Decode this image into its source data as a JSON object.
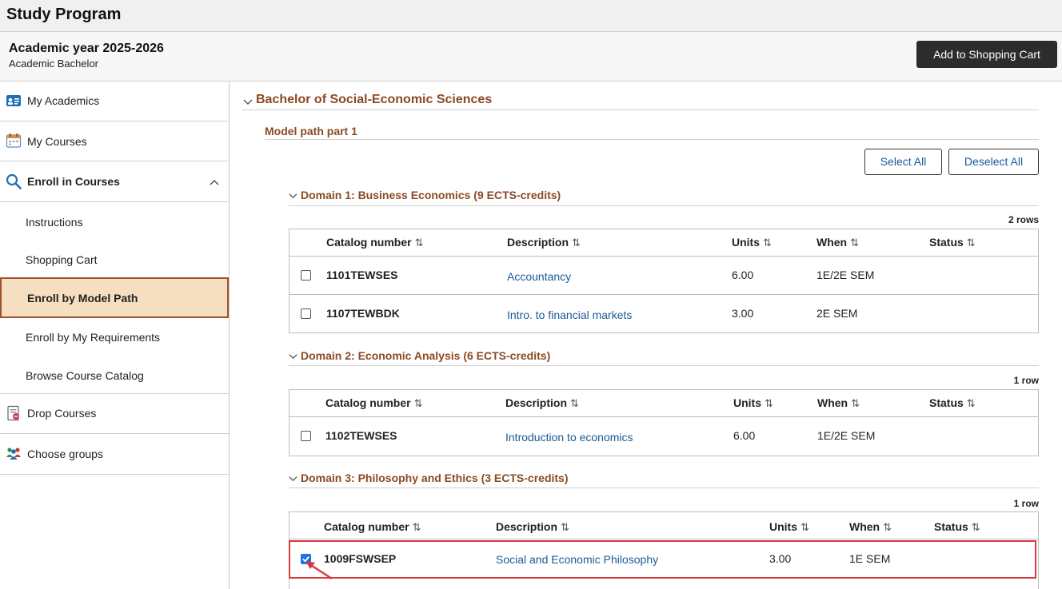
{
  "app": {
    "title": "Study Program"
  },
  "header": {
    "academic_year": "Academic year 2025-2026",
    "career": "Academic Bachelor",
    "add_to_cart_label": "Add to Shopping Cart"
  },
  "sidebar": {
    "items": [
      {
        "label": "My Academics",
        "icon": "id-card-icon"
      },
      {
        "label": "My Courses",
        "icon": "calendar-icon"
      },
      {
        "label": "Enroll in Courses",
        "icon": "search-icon"
      },
      {
        "label": "Instructions"
      },
      {
        "label": "Shopping Cart"
      },
      {
        "label": "Enroll by Model Path"
      },
      {
        "label": "Enroll by My Requirements"
      },
      {
        "label": "Browse Course Catalog"
      },
      {
        "label": "Drop Courses",
        "icon": "drop-doc-icon"
      },
      {
        "label": "Choose groups",
        "icon": "people-icon"
      }
    ],
    "active": "Enroll by Model Path"
  },
  "main": {
    "program_title": "Bachelor of Social-Economic Sciences",
    "model_path_title": "Model path part 1",
    "select_all_label": "Select All",
    "deselect_all_label": "Deselect All",
    "columns": [
      "Catalog number",
      "Description",
      "Units",
      "When",
      "Status"
    ],
    "sort_glyph": "⇅",
    "domains": [
      {
        "title": "Domain 1: Business Economics (9 ECTS-credits)",
        "rowcount": "2 rows",
        "rows": [
          {
            "catalog": "1101TEWSES",
            "description": "Accountancy",
            "units": "6.00",
            "when": "1E/2E SEM",
            "status": "",
            "checked": false
          },
          {
            "catalog": "1107TEWBDK",
            "description": "Intro. to financial markets",
            "units": "3.00",
            "when": "2E SEM",
            "status": "",
            "checked": false
          }
        ]
      },
      {
        "title": "Domain 2: Economic Analysis (6 ECTS-credits)",
        "rowcount": "1 row",
        "rows": [
          {
            "catalog": "1102TEWSES",
            "description": "Introduction to economics",
            "units": "6.00",
            "when": "1E/2E SEM",
            "status": "",
            "checked": false
          }
        ]
      },
      {
        "title": "Domain 3: Philosophy and Ethics (3 ECTS-credits)",
        "rowcount": "1 row",
        "rows": [
          {
            "catalog": "1009FSWSEP",
            "description": "Social and Economic Philosophy",
            "units": "3.00",
            "when": "1E SEM",
            "status": "",
            "checked": true
          }
        ]
      }
    ]
  },
  "colors": {
    "accent": "#8b4a22",
    "link": "#1a5a96",
    "active_bg": "#f5dfc0",
    "highlight": "#d9363e"
  }
}
